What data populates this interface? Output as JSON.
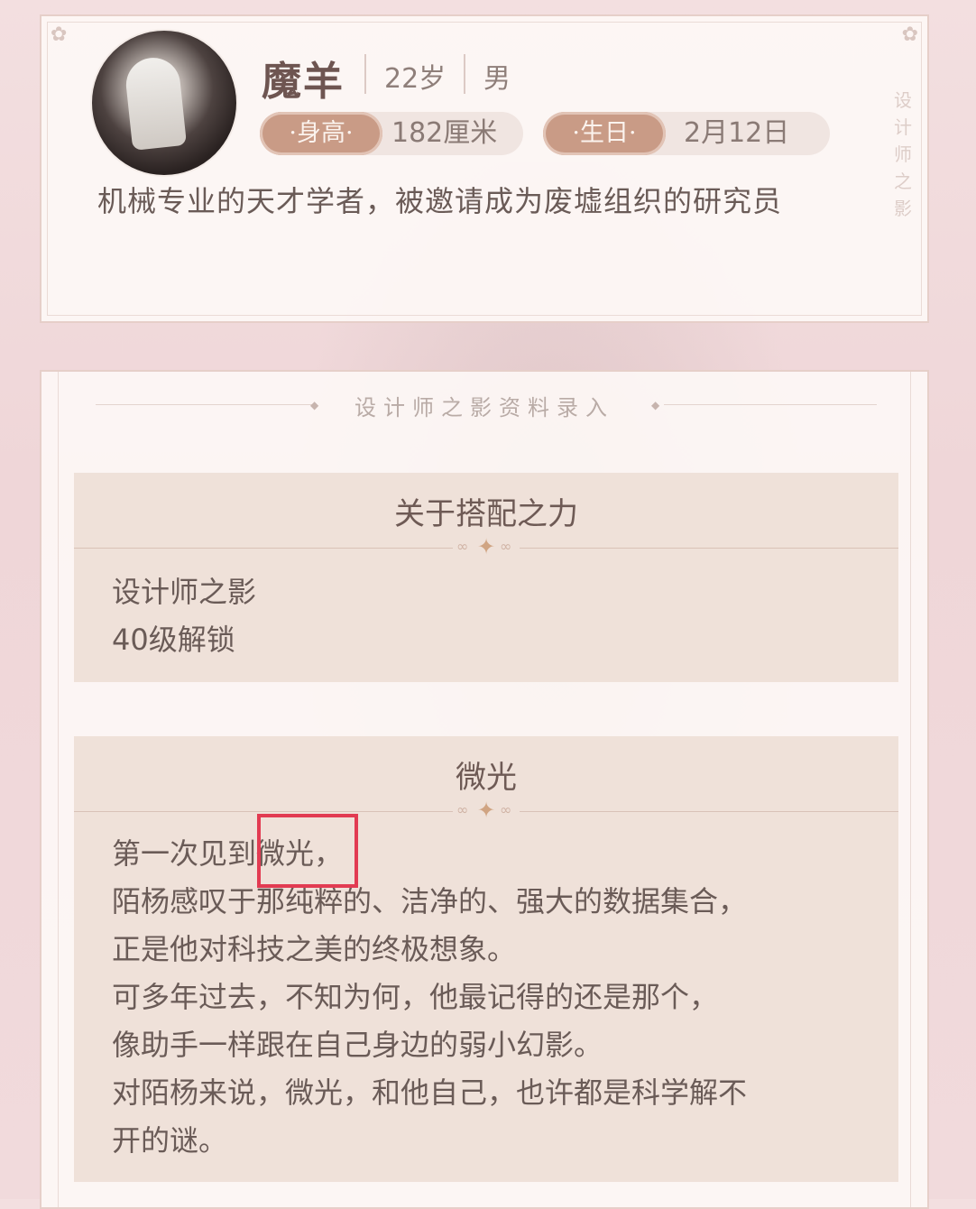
{
  "profile": {
    "name": "魔羊",
    "age": "22岁",
    "gender": "男",
    "height_label": "·身高·",
    "height_value": "182厘米",
    "birthday_label": "·生日·",
    "birthday_value": "2月12日",
    "intro": "机械专业的天才学者，被邀请成为废墟组织的研究员",
    "side_text": "设计师之影"
  },
  "archive": {
    "title": "设计师之影资料录入",
    "sections": [
      {
        "heading": "关于搭配之力",
        "lines": [
          "设计师之影",
          "40级解锁"
        ]
      },
      {
        "heading": "微光",
        "lines": [
          "第一次见到微光，",
          "陌杨感叹于那纯粹的、洁净的、强大的数据集合，",
          "正是他对科技之美的终极想象。",
          "可多年过去，不知为何，他最记得的还是那个，",
          "像助手一样跟在自己身边的弱小幻影。",
          "对陌杨来说，微光，和他自己，也许都是科学解不",
          "开的谜。"
        ]
      }
    ]
  },
  "colors": {
    "accent_tag": "#c99b86",
    "highlight_box": "#e23b52"
  }
}
